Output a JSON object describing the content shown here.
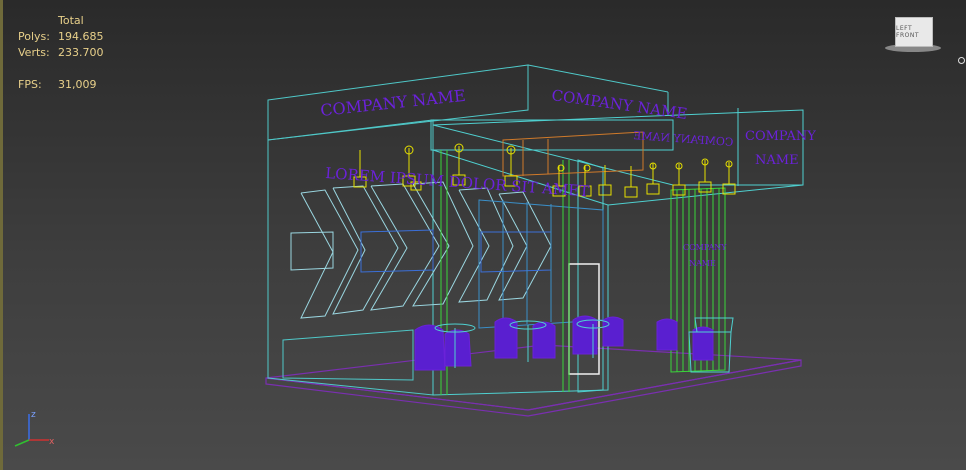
{
  "stats": {
    "header": "Total",
    "polys_label": "Polys:",
    "polys_value": "194.685",
    "verts_label": "Verts:",
    "verts_value": "233.700",
    "fps_label": "FPS:",
    "fps_value": "31,009"
  },
  "scene": {
    "signs": [
      "COMPANY NAME",
      "COMPANY NAME",
      "COMPANY NAME",
      "COMPANY",
      "NAME",
      "LOREM IPSUM DOLOR SIT AMET",
      "COMPANY",
      "NAME"
    ]
  },
  "viewcube": {
    "label": "LEFT FRONT"
  },
  "axis": {
    "z": "z",
    "x": "x"
  },
  "colors": {
    "stats_text": "#e8d08a",
    "wire_cyan": "#4fd0d0",
    "wire_green": "#3ad63a",
    "wire_purple": "#6b22d9",
    "wire_yellow": "#e6e000"
  }
}
